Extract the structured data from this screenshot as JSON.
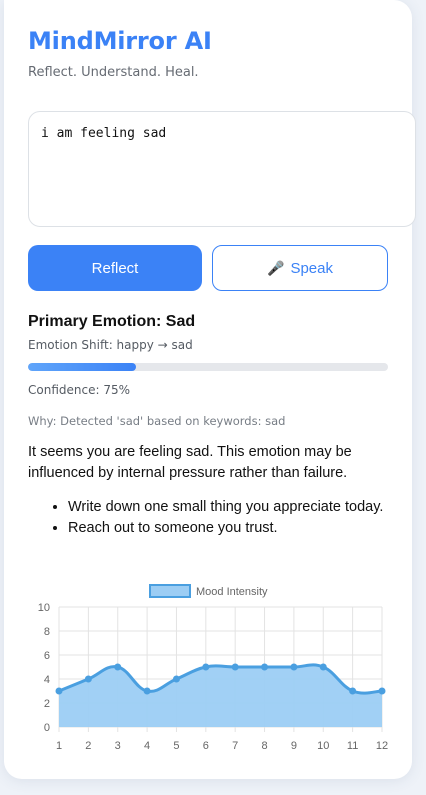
{
  "app": {
    "title": "MindMirror AI",
    "subtitle": "Reflect. Understand. Heal."
  },
  "input": {
    "value": "i am feeling sad"
  },
  "buttons": {
    "reflect_label": "Reflect",
    "speak_label": "Speak",
    "speak_icon": "microphone-icon"
  },
  "result": {
    "primary_emotion": "Primary Emotion: Sad",
    "emotion_shift": "Emotion Shift: happy → sad",
    "confidence_value": 0.3,
    "confidence_text": "Confidence: 75%",
    "why": "Why: Detected 'sad' based on keywords: sad",
    "message": "It seems you are feeling sad. This emotion may be influenced by internal pressure rather than failure.",
    "tips": [
      "Write down one small thing you appreciate today.",
      "Reach out to someone you trust."
    ]
  },
  "colors": {
    "accent": "#3b82f6",
    "chart_line": "#4a9fe0",
    "chart_fill": "#9ccdf4"
  },
  "chart_data": {
    "type": "area",
    "x": [
      1,
      2,
      3,
      4,
      5,
      6,
      7,
      8,
      9,
      10,
      11,
      12
    ],
    "series": [
      {
        "name": "Mood Intensity",
        "values": [
          3,
          4,
          5,
          3,
          4,
          5,
          5,
          5,
          5,
          5,
          3,
          3
        ]
      }
    ],
    "ylim": [
      0,
      10
    ],
    "yticks": [
      0,
      2,
      4,
      6,
      8,
      10
    ],
    "grid": true,
    "legend": "top"
  }
}
